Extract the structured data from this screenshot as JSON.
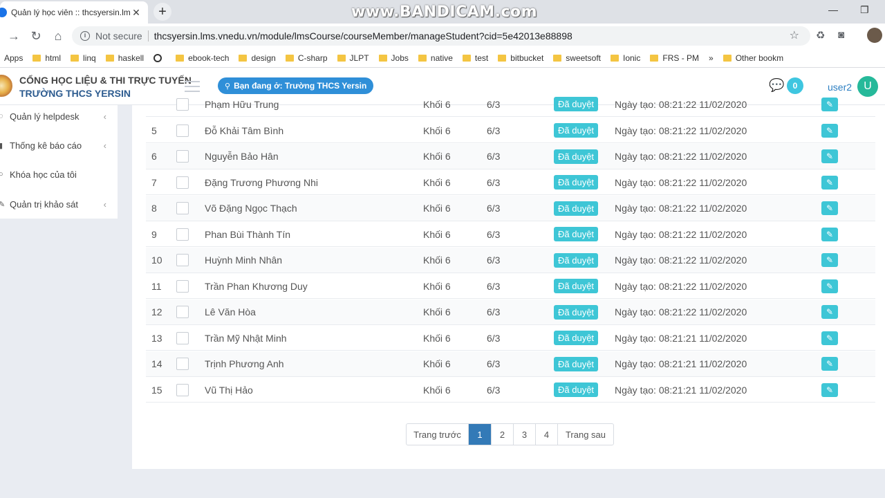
{
  "browser": {
    "tab_title": "Quản lý học viên :: thcsyersin.lms",
    "tab_close": "✕",
    "new_tab": "+",
    "watermark": "www.BANDICAM.com",
    "not_secure": "Not secure",
    "url": "thcsyersin.lms.vnedu.vn/module/lmsCourse/courseMember/manageStudent?cid=5e42013e88898",
    "bookmarks": [
      "Apps",
      "html",
      "linq",
      "haskell",
      "ebook-tech",
      "design",
      "C-sharp",
      "JLPT",
      "Jobs",
      "native",
      "test",
      "bitbucket",
      "sweetsoft",
      "Ionic",
      "FRS - PM"
    ],
    "more": "»",
    "other_bookmarks": "Other bookm"
  },
  "header": {
    "brand_line1": "CỔNG HỌC LIỆU & THI TRỰC TUYẾN",
    "brand_line2": "TRƯỜNG THCS YERSIN",
    "location": "Bạn đang ở: Trường THCS Yersin",
    "chat_count": "0",
    "username": "user2",
    "avatar_letter": "U"
  },
  "sidebar": {
    "items": [
      {
        "label": "Quản lý helpdesk",
        "chevron": "‹"
      },
      {
        "label": "Thống kê báo cáo",
        "chevron": "‹"
      },
      {
        "label": "Khóa học của tôi",
        "chevron": ""
      },
      {
        "label": "Quản trị khảo sát",
        "chevron": "‹"
      }
    ]
  },
  "table": {
    "partial_row": {
      "name": "Phạm Hữu Trung",
      "grade": "Khối 6",
      "class": "6/3",
      "status": "Đã duyệt",
      "created": "Ngày tạo: 08:21:22 11/02/2020"
    },
    "rows": [
      {
        "no": "5",
        "name": "Đỗ Khải Tâm Bình",
        "grade": "Khối 6",
        "class": "6/3",
        "status": "Đã duyệt",
        "created": "Ngày tạo: 08:21:22 11/02/2020"
      },
      {
        "no": "6",
        "name": "Nguyễn Bảo Hân",
        "grade": "Khối 6",
        "class": "6/3",
        "status": "Đã duyệt",
        "created": "Ngày tạo: 08:21:22 11/02/2020"
      },
      {
        "no": "7",
        "name": "Đặng Trương Phương Nhi",
        "grade": "Khối 6",
        "class": "6/3",
        "status": "Đã duyệt",
        "created": "Ngày tạo: 08:21:22 11/02/2020"
      },
      {
        "no": "8",
        "name": "Võ Đặng Ngọc Thạch",
        "grade": "Khối 6",
        "class": "6/3",
        "status": "Đã duyệt",
        "created": "Ngày tạo: 08:21:22 11/02/2020"
      },
      {
        "no": "9",
        "name": "Phan Bùi Thành Tín",
        "grade": "Khối 6",
        "class": "6/3",
        "status": "Đã duyệt",
        "created": "Ngày tạo: 08:21:22 11/02/2020"
      },
      {
        "no": "10",
        "name": "Huỳnh Minh Nhân",
        "grade": "Khối 6",
        "class": "6/3",
        "status": "Đã duyệt",
        "created": "Ngày tạo: 08:21:22 11/02/2020"
      },
      {
        "no": "11",
        "name": "Trần Phan Khương Duy",
        "grade": "Khối 6",
        "class": "6/3",
        "status": "Đã duyệt",
        "created": "Ngày tạo: 08:21:22 11/02/2020"
      },
      {
        "no": "12",
        "name": "Lê Văn Hòa",
        "grade": "Khối 6",
        "class": "6/3",
        "status": "Đã duyệt",
        "created": "Ngày tạo: 08:21:22 11/02/2020"
      },
      {
        "no": "13",
        "name": "Trần Mỹ Nhật Minh",
        "grade": "Khối 6",
        "class": "6/3",
        "status": "Đã duyệt",
        "created": "Ngày tạo: 08:21:21 11/02/2020"
      },
      {
        "no": "14",
        "name": "Trịnh Phương Anh",
        "grade": "Khối 6",
        "class": "6/3",
        "status": "Đã duyệt",
        "created": "Ngày tạo: 08:21:21 11/02/2020"
      },
      {
        "no": "15",
        "name": "Vũ Thị Hảo",
        "grade": "Khối 6",
        "class": "6/3",
        "status": "Đã duyệt",
        "created": "Ngày tạo: 08:21:21 11/02/2020"
      }
    ]
  },
  "pagination": {
    "prev": "Trang trước",
    "pages": [
      "1",
      "2",
      "3",
      "4"
    ],
    "active": "1",
    "next": "Trang sau"
  },
  "colors": {
    "badge": "#3ec6d6",
    "active_page": "#337ab7",
    "location_pill": "#2f8fd8",
    "brand_blue": "#2c5b8f"
  }
}
